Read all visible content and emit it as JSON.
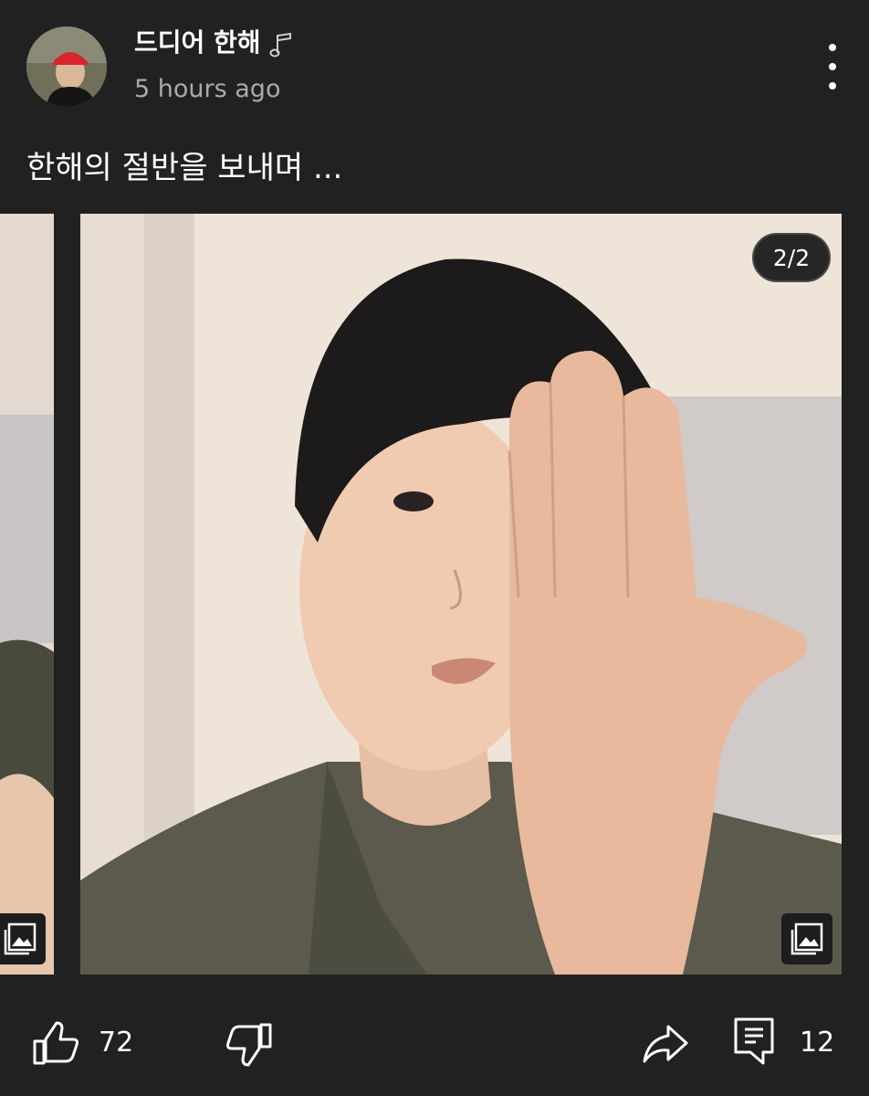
{
  "theme": {
    "background": "#212121",
    "muted_text": "#aaaaaa",
    "wall": "#efe4d8",
    "shirt": "#5b5a4d"
  },
  "post": {
    "channel_name": "드디어 한해",
    "time_ago": "5 hours ago",
    "text": "한해의 절반을 보내며 ...",
    "music_icon": "music-note-icon",
    "more_icon": "more-vertical-icon"
  },
  "carousel": {
    "counter": "2/2",
    "current_index": 2,
    "total": 2,
    "gallery_icon": "image-gallery-icon"
  },
  "actions": {
    "like_count": "72",
    "comment_count": "12",
    "like_icon": "thumbs-up-icon",
    "dislike_icon": "thumbs-down-icon",
    "share_icon": "share-icon",
    "comment_icon": "comment-icon"
  }
}
